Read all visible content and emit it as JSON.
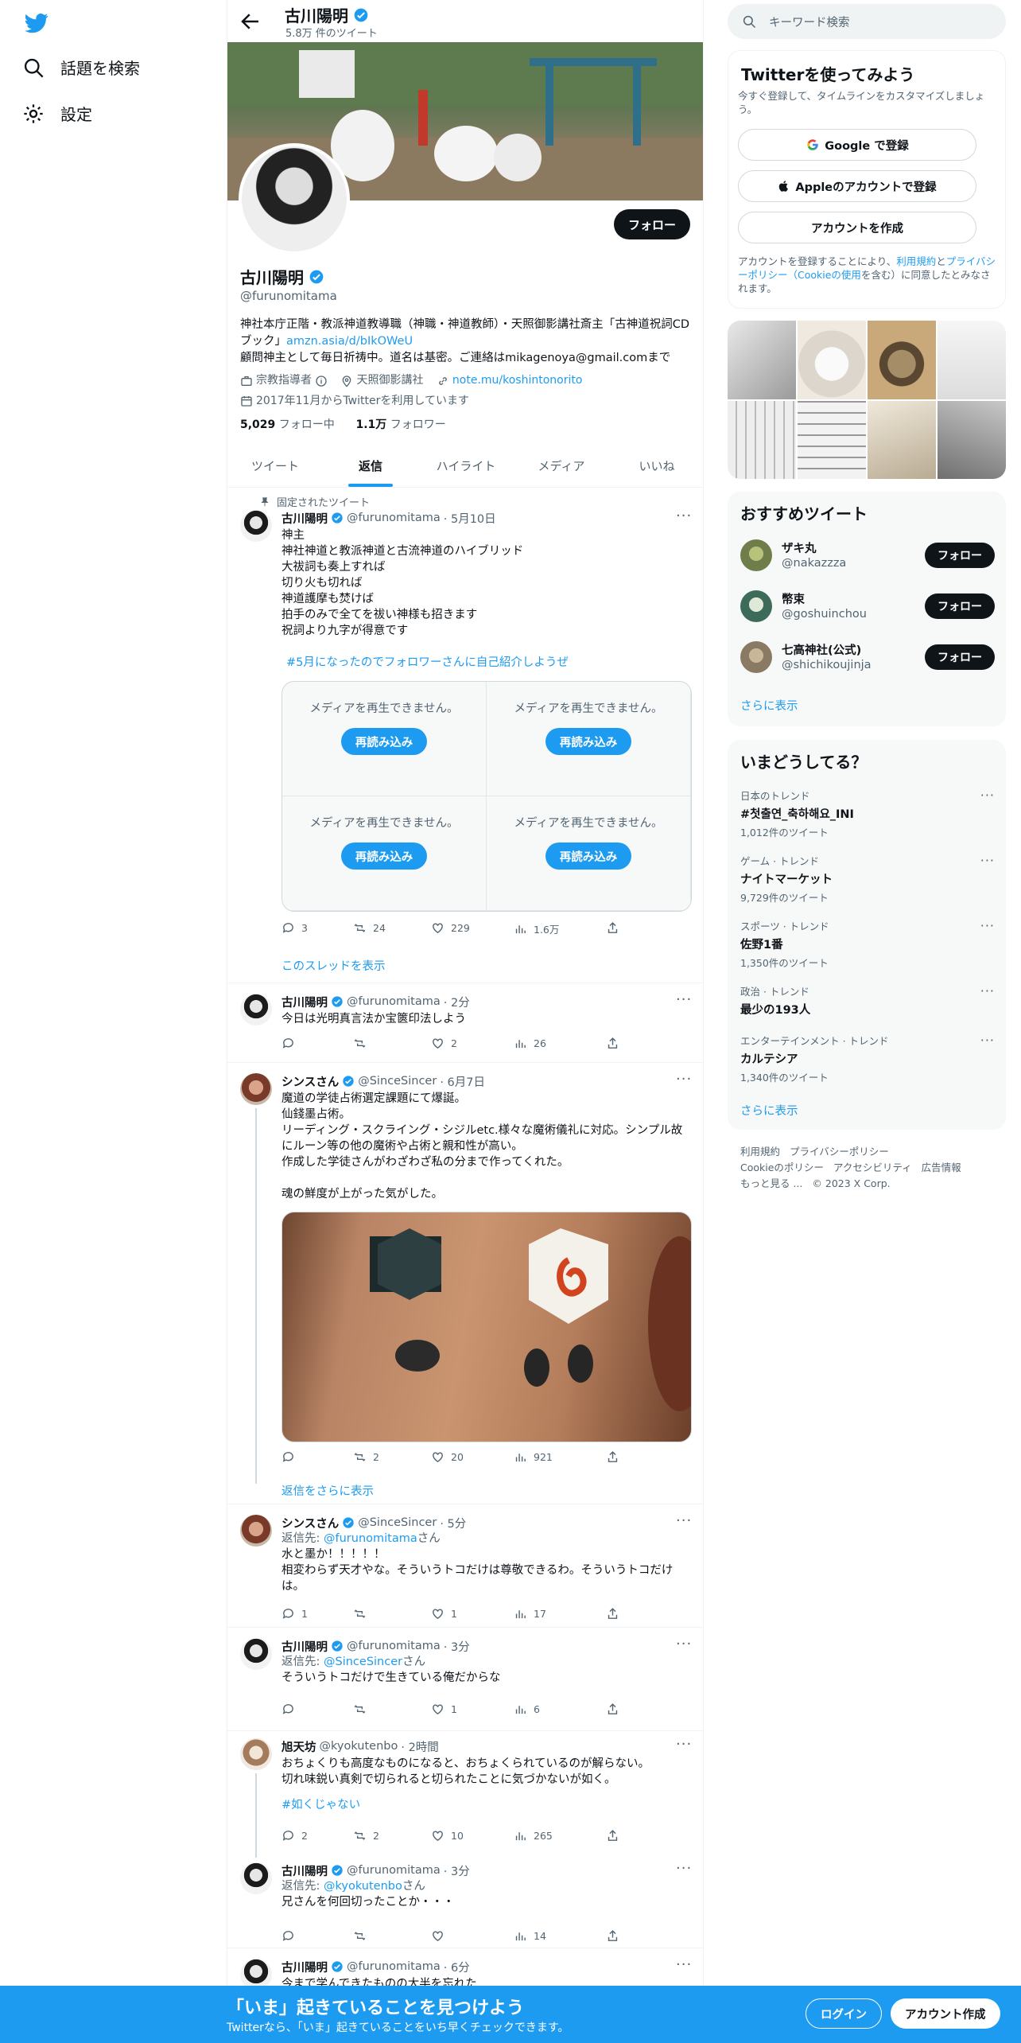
{
  "nav": {
    "explore": "話題を検索",
    "settings": "設定"
  },
  "profile_header": {
    "name": "古川陽明",
    "tweet_count": "5.8万 件のツイート"
  },
  "profile": {
    "follow": "フォロー",
    "name": "古川陽明",
    "handle": "@furunomitama",
    "bio_1": "神社本庁正階・教派神道教導職（神職・神道教師）・天照御影講社斎主「古神道祝詞CDブック」",
    "bio_link": "amzn.asia/d/bIkOWeU",
    "bio_2": "顧問神主として毎日祈祷中。道名は基密。ご連絡はmikagenoya@gmail.comまで",
    "category": "宗教指導者",
    "location": "天照御影講社",
    "website": "note.mu/koshintonorito",
    "joined": "2017年11月からTwitterを利用しています",
    "following_count": "5,029",
    "following_label": "フォロー中",
    "followers_count": "1.1万",
    "followers_label": "フォロワー"
  },
  "tabs": [
    "ツイート",
    "返信",
    "ハイライト",
    "メディア",
    "いいね"
  ],
  "pinned_label": "固定されたツイート",
  "tweets": [
    {
      "name": "古川陽明",
      "handle": "@furunomitama",
      "time": "· 5月10日",
      "text": "神主\n神社神道と教派神道と古流神道のハイブリッド\n大祓詞も奏上すれば\n切り火も切れば\n神道護摩も焚けば\n拍手のみで全てを祓い神様も招きます\n祝詞より九字が得意です",
      "hashtag": "#5月になったのでフォロワーさんに自己紹介しようぜ",
      "media_error": "メディアを再生できません。",
      "reload": "再読み込み",
      "replies": "3",
      "retweets": "24",
      "likes": "229",
      "views": "1.6万",
      "show_thread": "このスレッドを表示"
    },
    {
      "name": "古川陽明",
      "handle": "@furunomitama",
      "time": "· 2分",
      "text": "今日は光明真言法か宝篋印法しよう",
      "replies": "",
      "retweets": "",
      "likes": "2",
      "views": "26"
    },
    {
      "name": "シンスさん",
      "handle": "@SinceSincer",
      "time": "· 6月7日",
      "text": "魔道の学徒占術選定課題にて爆誕。\n仙錢墨占術。\nリーディング・スクライング・シジルetc.様々な魔術儀礼に対応。シンプル故にルーン等の他の魔術や占術と親和性が高い。\n作成した学徒さんがわざわざ私の分まで作ってくれた。\n\n魂の鮮度が上がった気がした。",
      "replies": "",
      "retweets": "2",
      "likes": "20",
      "views": "921",
      "show_more": "返信をさらに表示"
    },
    {
      "name": "シンスさん",
      "handle": "@SinceSincer",
      "time": "· 5分",
      "reply_prefix": "返信先:",
      "reply_to": "@furunomitama",
      "reply_suffix": "さん",
      "text": "水と墨か！！！！！\n相変わらず天才やな。そういうトコだけは尊敬できるわ。そういうトコだけは。",
      "replies": "1",
      "retweets": "",
      "likes": "1",
      "views": "17"
    },
    {
      "name": "古川陽明",
      "handle": "@furunomitama",
      "time": "· 3分",
      "reply_prefix": "返信先:",
      "reply_to": "@SinceSincer",
      "reply_suffix": "さん",
      "text": "そういうトコだけで生きている俺だからな",
      "replies": "",
      "retweets": "",
      "likes": "1",
      "views": "6"
    },
    {
      "name": "旭天坊",
      "handle": "@kyokutenbo",
      "time": "· 2時間",
      "text": "おちょくりも高度なものになると、おちょくられているのが解らない。\n切れ味鋭い真剣で切られると切られたことに気づかないが如く。",
      "hashtag": "#如くじゃない",
      "replies": "2",
      "retweets": "2",
      "likes": "10",
      "views": "265"
    },
    {
      "name": "古川陽明",
      "handle": "@furunomitama",
      "time": "· 3分",
      "reply_prefix": "返信先:",
      "reply_to": "@kyokutenbo",
      "reply_suffix": "さん",
      "text": "兄さんを何回切ったことか・・・",
      "replies": "",
      "retweets": "",
      "likes": "",
      "views": "14"
    },
    {
      "name": "古川陽明",
      "handle": "@furunomitama",
      "time": "· 6分",
      "text": "今まで学んできたものの大半を忘れた"
    }
  ],
  "right": {
    "search_placeholder": "キーワード検索",
    "signup_title": "Twitterを使ってみよう",
    "signup_sub": "今すぐ登録して、タイムラインをカスタマイズしましょう。",
    "google": "Google で登録",
    "apple": "Appleのアカウントで登録",
    "create": "アカウントを作成",
    "terms_1": "アカウントを登録することにより、",
    "terms_link1": "利用規約",
    "terms_2": "と",
    "terms_link2": "プライバシーポリシー（Cookieの使用",
    "terms_3": "を含む）に同意したとみなされます。",
    "rec_title": "おすすめツイート",
    "rec": [
      {
        "name": "ザキ丸",
        "handle": "@nakazzza",
        "follow": "フォロー",
        "color": "#6f7d4a"
      },
      {
        "name": "幣束",
        "handle": "@goshuinchou",
        "follow": "フォロー",
        "color": "#3d6b5a"
      },
      {
        "name": "七高神社(公式)",
        "handle": "@shichikoujinja",
        "follow": "フォロー",
        "color": "#8a7a64"
      }
    ],
    "rec_more": "さらに表示",
    "trend_title": "いまどうしてる？",
    "trends": [
      {
        "cat": "日本のトレンド",
        "name": "#첫출연_축하해요_INI",
        "count": "1,012件のツイート"
      },
      {
        "cat": "ゲーム · トレンド",
        "name": "ナイトマーケット",
        "count": "9,729件のツイート"
      },
      {
        "cat": "スポーツ · トレンド",
        "name": "佐野1番",
        "count": "1,350件のツイート"
      },
      {
        "cat": "政治 · トレンド",
        "name": "最少の193人",
        "count": ""
      },
      {
        "cat": "エンターテインメント · トレンド",
        "name": "カルテシア",
        "count": "1,340件のツイート"
      }
    ],
    "trend_more": "さらに表示",
    "footer": [
      "利用規約",
      "プライバシーポリシー",
      "Cookieのポリシー",
      "アクセシビリティ",
      "広告情報",
      "もっと見る ...",
      "© 2023 X Corp."
    ]
  },
  "bottom": {
    "title": "「いま」起きていることを見つけよう",
    "sub": "Twitterなら、「いま」起きていることをいち早くチェックできます。",
    "login": "ログイン",
    "signup": "アカウント作成"
  },
  "colors": {
    "accent": "#1d9bf0",
    "text": "#0f1419",
    "muted": "#536471"
  }
}
